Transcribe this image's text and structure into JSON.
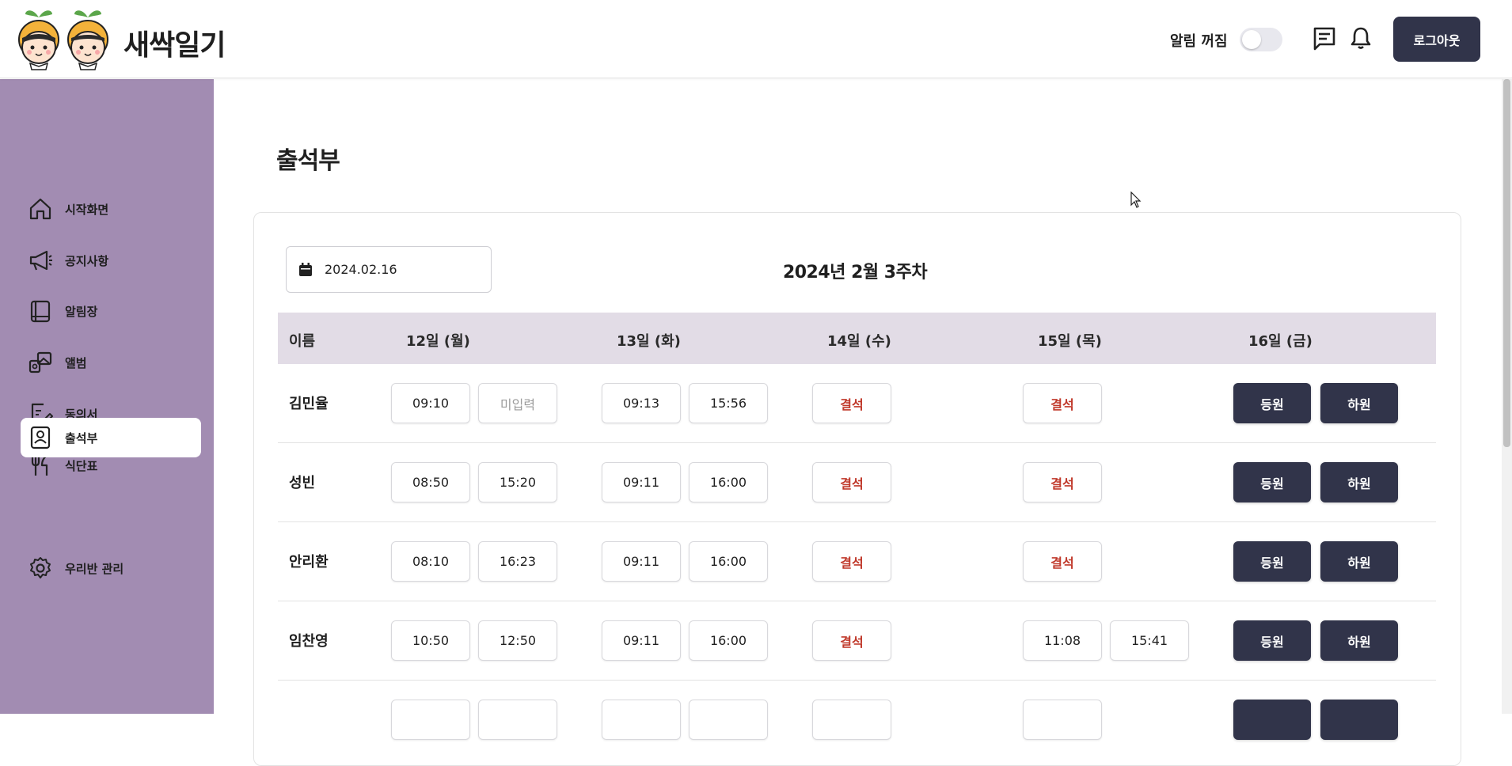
{
  "header": {
    "logo_text": "새싹일기",
    "notify_label": "알림 꺼짐",
    "notify_enabled": false,
    "logout_label": "로그아웃"
  },
  "sidebar": {
    "items": [
      {
        "label": "시작화면",
        "icon": "home-icon"
      },
      {
        "label": "공지사항",
        "icon": "megaphone-icon"
      },
      {
        "label": "알림장",
        "icon": "notebook-icon"
      },
      {
        "label": "앨범",
        "icon": "album-icon"
      },
      {
        "label": "동의서",
        "icon": "consent-form-icon"
      },
      {
        "label": "식단표",
        "icon": "fork-knife-icon"
      },
      {
        "label": "출석부",
        "icon": "attendance-icon",
        "active": true
      },
      {
        "label": "우리반 관리",
        "icon": "gear-icon"
      }
    ]
  },
  "main": {
    "title": "출석부",
    "date_value": "2024.02.16",
    "week_title": "2024년 2월 3주차",
    "columns": [
      "이름",
      "12일 (월)",
      "13일 (화)",
      "14일 (수)",
      "15일 (목)",
      "16일 (금)"
    ],
    "arrive_label": "등원",
    "leave_label": "하원",
    "rows": [
      {
        "name": "김민율",
        "mon": [
          "09:10",
          "미입력"
        ],
        "tue": [
          "09:13",
          "15:56"
        ],
        "wed": "결석",
        "thu": "결석"
      },
      {
        "name": "성빈",
        "mon": [
          "08:50",
          "15:20"
        ],
        "tue": [
          "09:11",
          "16:00"
        ],
        "wed": "결석",
        "thu": "결석"
      },
      {
        "name": "안리환",
        "mon": [
          "08:10",
          "16:23"
        ],
        "tue": [
          "09:11",
          "16:00"
        ],
        "wed": "결석",
        "thu": "결석"
      },
      {
        "name": "임찬영",
        "mon": [
          "10:50",
          "12:50"
        ],
        "tue": [
          "09:11",
          "16:00"
        ],
        "wed": "결석",
        "thu": [
          "11:08",
          "15:41"
        ]
      }
    ]
  },
  "colors": {
    "sidebar_bg": "#a28cb2",
    "table_header_bg": "#e2dce6",
    "dark_button": "#31344a",
    "absent_text": "#c0392b"
  }
}
